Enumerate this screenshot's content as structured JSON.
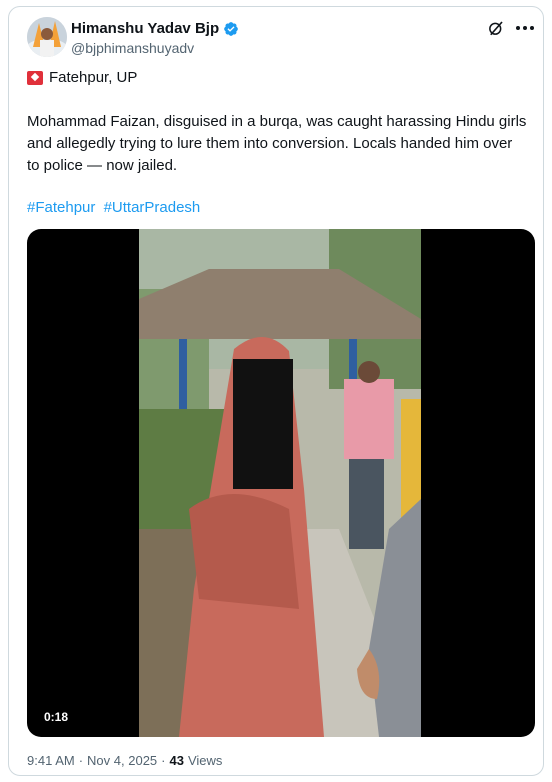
{
  "author": {
    "display_name": "Himanshu Yadav Bjp",
    "handle": "@bjphimanshuyadv",
    "verified": true
  },
  "post": {
    "location_icon": "siren-emoji",
    "location": "Fatehpur, UP",
    "text": "Mohammad Faizan, disguised in a burqa, was caught harassing Hindu girls and allegedly trying to lure them into conversion. Locals handed him over to police — now jailed.",
    "hashtags": [
      "#Fatehpur",
      "#UttarPradesh"
    ]
  },
  "media": {
    "type": "video",
    "duration": "0:18"
  },
  "meta": {
    "time": "9:41 AM",
    "separator": "·",
    "date": "Nov 4, 2025",
    "views_count": "43",
    "views_label": "Views"
  },
  "colors": {
    "link": "#1d9bf0",
    "verified": "#1d9bf0",
    "muted": "#536471",
    "border": "#cfd9de"
  },
  "icons": {
    "grok": "grok-icon",
    "more": "more-options-icon",
    "verified": "verified-badge-icon"
  }
}
